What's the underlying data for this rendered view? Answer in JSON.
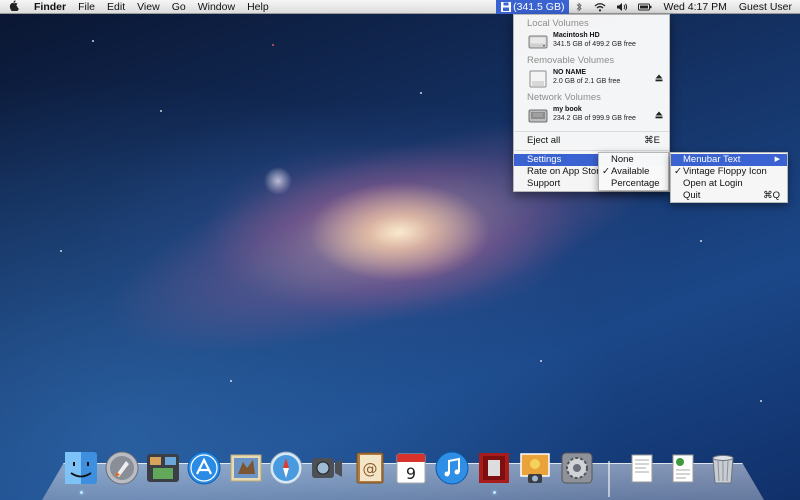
{
  "menubar": {
    "apple_icon": "apple-logo-icon",
    "app_name": "Finder",
    "menus": [
      "File",
      "Edit",
      "View",
      "Go",
      "Window",
      "Help"
    ],
    "status_item_text": "(341.5 GB)",
    "status_icons": [
      "floppy-disk-icon",
      "bluetooth-icon",
      "wifi-icon",
      "volume-icon",
      "battery-icon"
    ],
    "clock": "Wed 4:17 PM",
    "user": "Guest User"
  },
  "dropdown": {
    "local_header": "Local Volumes",
    "local_volumes": [
      {
        "name": "Macintosh HD",
        "info": "341.5 GB of 499.2 GB free",
        "icon": "hard-drive-icon"
      }
    ],
    "removable_header": "Removable Volumes",
    "removable_volumes": [
      {
        "name": "NO NAME",
        "info": "2.0 GB of 2.1 GB free",
        "icon": "removable-drive-icon"
      }
    ],
    "network_header": "Network Volumes",
    "network_volumes": [
      {
        "name": "my book",
        "info": "234.2 GB of 999.9 GB free",
        "icon": "network-drive-icon"
      }
    ],
    "eject_all": "Eject all",
    "eject_all_shortcut": "⌘E",
    "settings": "Settings",
    "rate": "Rate on App Store",
    "support": "Support"
  },
  "submenu_display": {
    "items": [
      "None",
      "Available",
      "Percentage"
    ],
    "checked": "Available"
  },
  "submenu_settings": {
    "menubar_text": "Menubar Text",
    "vintage": "Vintage Floppy Icon",
    "open_at_login": "Open at Login",
    "quit": "Quit",
    "quit_shortcut": "⌘Q"
  },
  "dock": {
    "apps": [
      "finder-icon",
      "launchpad-icon",
      "mission-control-icon",
      "app-store-icon",
      "mail-icon",
      "safari-icon",
      "facetime-icon",
      "address-book-icon",
      "ical-icon",
      "itunes-icon",
      "photo-booth-icon",
      "iphoto-icon",
      "system-preferences-icon"
    ],
    "ical_day": "9",
    "stacks": [
      "documents-stack-icon",
      "downloads-stack-icon",
      "trash-icon"
    ]
  },
  "colors": {
    "highlight": "#3a63d1",
    "menubar_bg": "#e8e8e8",
    "menu_header_gray": "#8e8e8e"
  }
}
